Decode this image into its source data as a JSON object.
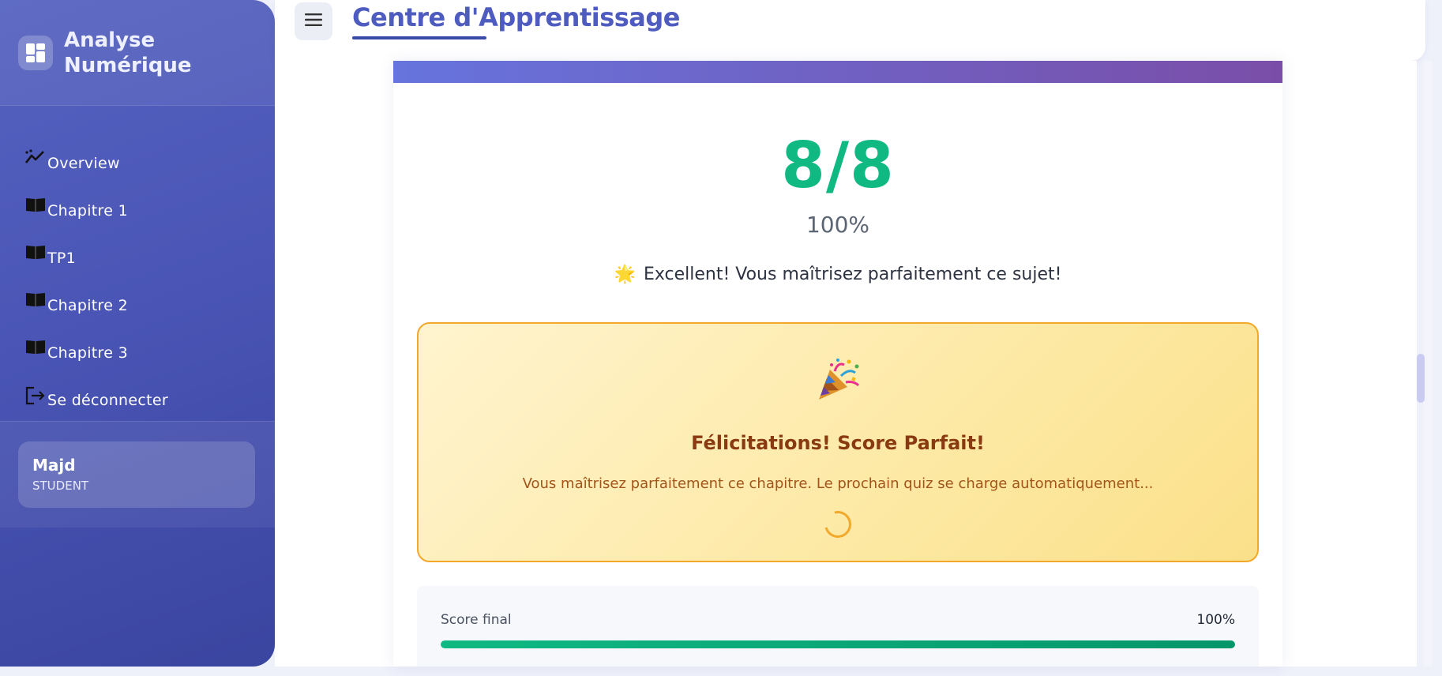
{
  "sidebar": {
    "brand": {
      "line1": "Analyse",
      "line2": "Numérique",
      "icon": "dashboard-icon"
    },
    "items": [
      {
        "label": "Overview",
        "icon": "trend-line-icon"
      },
      {
        "label": "Chapitre 1",
        "icon": "book-icon"
      },
      {
        "label": "TP1",
        "icon": "book-icon"
      },
      {
        "label": "Chapitre 2",
        "icon": "book-icon"
      },
      {
        "label": "Chapitre 3",
        "icon": "book-icon"
      },
      {
        "label": "Se déconnecter",
        "icon": "logout-icon"
      }
    ],
    "user": {
      "name": "Majd",
      "role": "STUDENT"
    }
  },
  "header": {
    "title": "Centre d'Apprentissage",
    "menu_icon": "hamburger-icon"
  },
  "result": {
    "score": "8/8",
    "percent": "100%",
    "message_icon": "🌟",
    "message": "Excellent! Vous maîtrisez parfaitement ce sujet!"
  },
  "congrats": {
    "icon": "party-popper-icon",
    "title": "Félicitations! Score Parfait!",
    "text": "Vous maîtrisez parfaitement ce chapitre. Le prochain quiz se charge automatiquement..."
  },
  "final_score": {
    "label": "Score final",
    "value": "100%",
    "progress": 1.0
  },
  "colors": {
    "accent": "#4e5cc0",
    "success": "#10b981",
    "warning_border": "#f2a82a",
    "congrats_title": "#8a3a10"
  }
}
